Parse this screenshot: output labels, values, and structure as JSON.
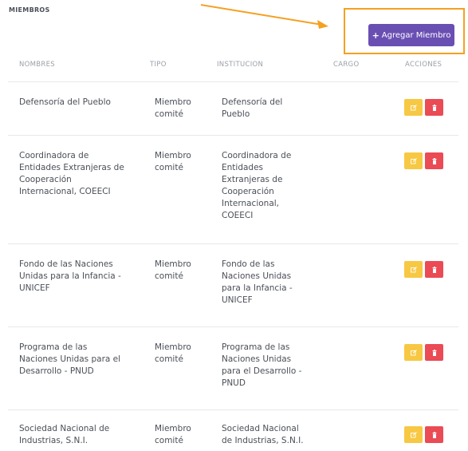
{
  "section": {
    "title": "MIEMBROS"
  },
  "toolbar": {
    "add_label": "Agregar Miembro",
    "add_icon": "plus-icon"
  },
  "table": {
    "columns": [
      "NOMBRES",
      "TIPO",
      "INSTITUCION",
      "CARGO",
      "ACCIONES"
    ],
    "rows": [
      {
        "nombre": "Defensoría del Pueblo",
        "tipo": "Miembro comité",
        "institucion": "Defensoría del Pueblo",
        "cargo": ""
      },
      {
        "nombre": "Coordinadora de Entidades Extranjeras de Cooperación Internacional, COEECI",
        "tipo": "Miembro comité",
        "institucion": "Coordinadora de Entidades Extranjeras de Cooperación Internacional, COEECI",
        "cargo": ""
      },
      {
        "nombre": "Fondo de las Naciones Unidas para la Infancia - UNICEF",
        "tipo": "Miembro comité",
        "institucion": "Fondo de las Naciones Unidas para la Infancia - UNICEF",
        "cargo": ""
      },
      {
        "nombre": "Programa de las Naciones Unidas para el Desarrollo - PNUD",
        "tipo": "Miembro comité",
        "institucion": "Programa de las Naciones Unidas para el Desarrollo - PNUD",
        "cargo": ""
      },
      {
        "nombre": "Sociedad Nacional de Industrias, S.N.I.",
        "tipo": "Miembro comité",
        "institucion": "Sociedad Nacional de Industrias, S.N.I.",
        "cargo": ""
      }
    ],
    "action_icons": {
      "edit": "edit-icon",
      "delete": "trash-icon"
    }
  },
  "colors": {
    "primary_button": "#6a4fb3",
    "edit_button": "#f7c843",
    "delete_button": "#ea4b55",
    "highlight": "#f5a020"
  }
}
